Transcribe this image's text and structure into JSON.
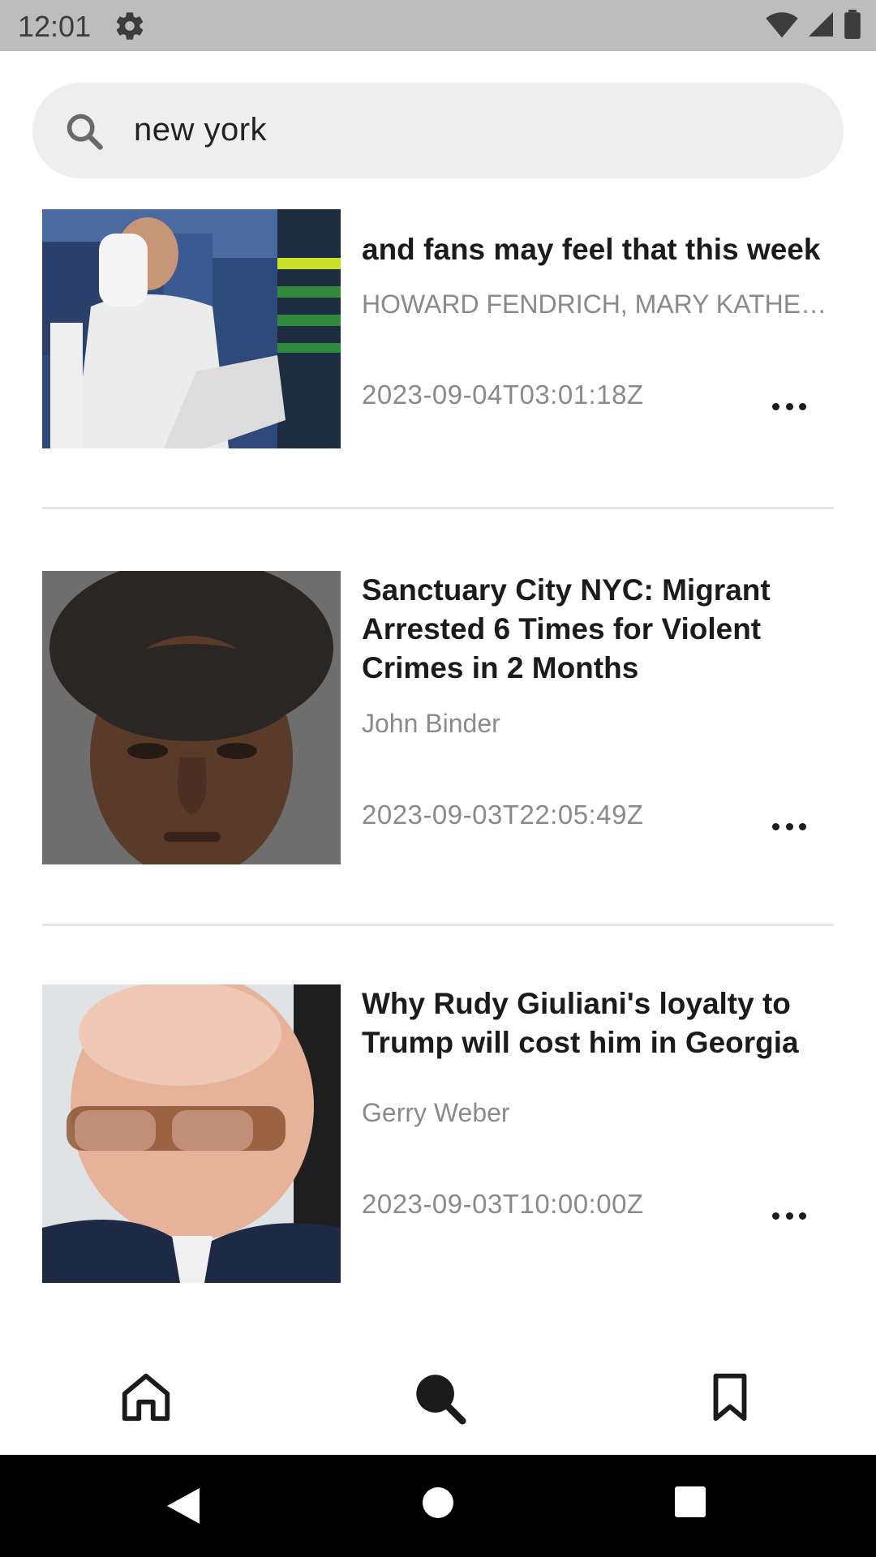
{
  "status_bar": {
    "time": "12:01",
    "icons": [
      "gear-icon",
      "wifi-icon",
      "signal-icon",
      "battery-icon"
    ]
  },
  "search": {
    "query": "new york",
    "icon": "search-icon"
  },
  "articles": [
    {
      "title": "getting hotter: US Open players and fans may feel that this week",
      "title_visible": "and fans may feel that this week",
      "author": "HOWARD FENDRICH, MARY KATHER...",
      "date": "2023-09-04T03:01:18Z",
      "image": "tennis-player-towel-photo"
    },
    {
      "title": "Sanctuary City NYC: Migrant Arrested 6 Times for Violent Crimes in 2 Months",
      "author": "John Binder",
      "date": "2023-09-03T22:05:49Z",
      "image": "mugshot-photo"
    },
    {
      "title": "Why Rudy Giuliani's loyalty to Trump will cost him in Georgia",
      "author": "Gerry Weber",
      "date": "2023-09-03T10:00:00Z",
      "image": "giuliani-portrait-photo"
    }
  ],
  "bottom_nav": {
    "items": [
      "home-icon",
      "search-icon",
      "bookmark-icon"
    ],
    "active": "search"
  },
  "system_nav": [
    "back-icon",
    "home-circle-icon",
    "recents-icon"
  ]
}
